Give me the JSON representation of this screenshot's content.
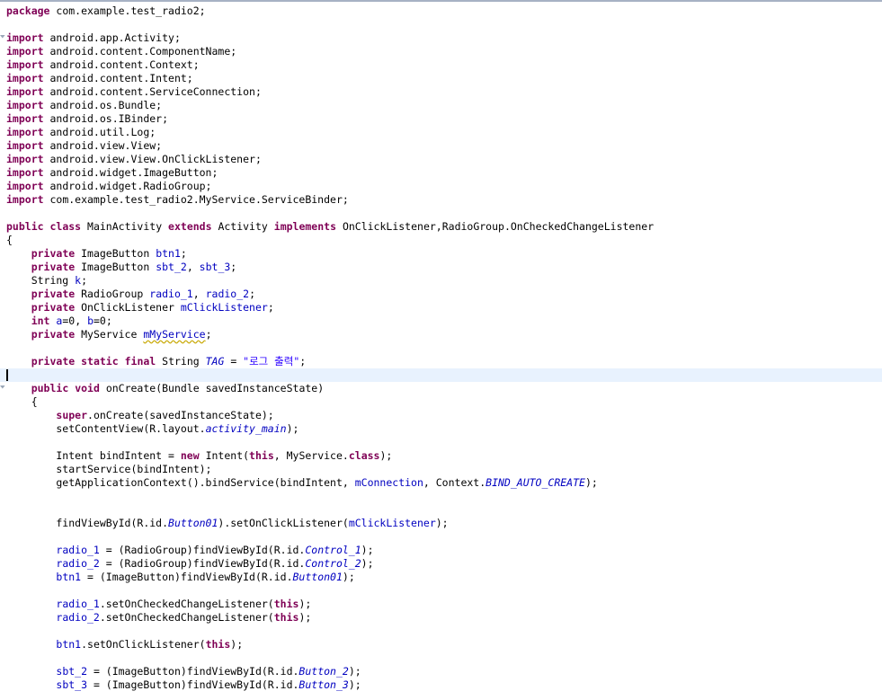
{
  "theme": {
    "keyword_color": "#7f0055",
    "field_color": "#0000c0",
    "string_color": "#2a00ff",
    "current_line_bg": "#e8f2fe"
  },
  "current_line_index": 27,
  "fold_markers": [
    2,
    28
  ],
  "code_lines": [
    [
      {
        "t": "package",
        "k": "kw"
      },
      {
        "t": " com.example.test_radio2;"
      }
    ],
    [],
    [
      {
        "t": "import",
        "k": "kw"
      },
      {
        "t": " android.app.Activity;"
      }
    ],
    [
      {
        "t": "import",
        "k": "kw"
      },
      {
        "t": " android.content.ComponentName;"
      }
    ],
    [
      {
        "t": "import",
        "k": "kw"
      },
      {
        "t": " android.content.Context;"
      }
    ],
    [
      {
        "t": "import",
        "k": "kw"
      },
      {
        "t": " android.content.Intent;"
      }
    ],
    [
      {
        "t": "import",
        "k": "kw"
      },
      {
        "t": " android.content.ServiceConnection;"
      }
    ],
    [
      {
        "t": "import",
        "k": "kw"
      },
      {
        "t": " android.os.Bundle;"
      }
    ],
    [
      {
        "t": "import",
        "k": "kw"
      },
      {
        "t": " android.os.IBinder;"
      }
    ],
    [
      {
        "t": "import",
        "k": "kw"
      },
      {
        "t": " android.util.Log;"
      }
    ],
    [
      {
        "t": "import",
        "k": "kw"
      },
      {
        "t": " android.view.View;"
      }
    ],
    [
      {
        "t": "import",
        "k": "kw"
      },
      {
        "t": " android.view.View.OnClickListener;"
      }
    ],
    [
      {
        "t": "import",
        "k": "kw"
      },
      {
        "t": " android.widget.ImageButton;"
      }
    ],
    [
      {
        "t": "import",
        "k": "kw"
      },
      {
        "t": " android.widget.RadioGroup;"
      }
    ],
    [
      {
        "t": "import",
        "k": "kw"
      },
      {
        "t": " com.example.test_radio2.MyService.ServiceBinder;"
      }
    ],
    [],
    [
      {
        "t": "public",
        "k": "kw"
      },
      {
        "t": " "
      },
      {
        "t": "class",
        "k": "kw"
      },
      {
        "t": " MainActivity "
      },
      {
        "t": "extends",
        "k": "kw"
      },
      {
        "t": " Activity "
      },
      {
        "t": "implements",
        "k": "kw"
      },
      {
        "t": " OnClickListener,RadioGroup.OnCheckedChangeListener"
      }
    ],
    [
      {
        "t": "{"
      }
    ],
    [
      {
        "t": "    "
      },
      {
        "t": "private",
        "k": "kw"
      },
      {
        "t": " ImageButton "
      },
      {
        "t": "btn1",
        "k": "field"
      },
      {
        "t": ";"
      }
    ],
    [
      {
        "t": "    "
      },
      {
        "t": "private",
        "k": "kw"
      },
      {
        "t": " ImageButton "
      },
      {
        "t": "sbt_2",
        "k": "field"
      },
      {
        "t": ", "
      },
      {
        "t": "sbt_3",
        "k": "field"
      },
      {
        "t": ";"
      }
    ],
    [
      {
        "t": "    String "
      },
      {
        "t": "k",
        "k": "field"
      },
      {
        "t": ";"
      }
    ],
    [
      {
        "t": "    "
      },
      {
        "t": "private",
        "k": "kw"
      },
      {
        "t": " RadioGroup "
      },
      {
        "t": "radio_1",
        "k": "field"
      },
      {
        "t": ", "
      },
      {
        "t": "radio_2",
        "k": "field"
      },
      {
        "t": ";"
      }
    ],
    [
      {
        "t": "    "
      },
      {
        "t": "private",
        "k": "kw"
      },
      {
        "t": " OnClickListener "
      },
      {
        "t": "mClickListener",
        "k": "field"
      },
      {
        "t": ";"
      }
    ],
    [
      {
        "t": "    "
      },
      {
        "t": "int",
        "k": "kw"
      },
      {
        "t": " "
      },
      {
        "t": "a",
        "k": "field"
      },
      {
        "t": "=0, "
      },
      {
        "t": "b",
        "k": "field"
      },
      {
        "t": "=0;"
      }
    ],
    [
      {
        "t": "    "
      },
      {
        "t": "private",
        "k": "kw"
      },
      {
        "t": " MyService "
      },
      {
        "t": "mMyService",
        "k": "field warn"
      },
      {
        "t": ";"
      }
    ],
    [],
    [
      {
        "t": "    "
      },
      {
        "t": "private",
        "k": "kw"
      },
      {
        "t": " "
      },
      {
        "t": "static",
        "k": "kw"
      },
      {
        "t": " "
      },
      {
        "t": "final",
        "k": "kw"
      },
      {
        "t": " String "
      },
      {
        "t": "TAG",
        "k": "static-field"
      },
      {
        "t": " = "
      },
      {
        "t": "\"로그 출력\"",
        "k": "str"
      },
      {
        "t": ";"
      }
    ],
    [],
    [
      {
        "t": "    "
      },
      {
        "t": "public",
        "k": "kw"
      },
      {
        "t": " "
      },
      {
        "t": "void",
        "k": "kw"
      },
      {
        "t": " onCreate(Bundle savedInstanceState)"
      }
    ],
    [
      {
        "t": "    {"
      }
    ],
    [
      {
        "t": "        "
      },
      {
        "t": "super",
        "k": "kw"
      },
      {
        "t": ".onCreate(savedInstanceState);"
      }
    ],
    [
      {
        "t": "        setContentView(R.layout."
      },
      {
        "t": "activity_main",
        "k": "static-field"
      },
      {
        "t": ");"
      }
    ],
    [],
    [
      {
        "t": "        Intent bindIntent = "
      },
      {
        "t": "new",
        "k": "kw"
      },
      {
        "t": " Intent("
      },
      {
        "t": "this",
        "k": "kw"
      },
      {
        "t": ", MyService."
      },
      {
        "t": "class",
        "k": "kw"
      },
      {
        "t": ");"
      }
    ],
    [
      {
        "t": "        startService(bindIntent);"
      }
    ],
    [
      {
        "t": "        getApplicationContext().bindService(bindIntent, "
      },
      {
        "t": "mConnection",
        "k": "field"
      },
      {
        "t": ", Context."
      },
      {
        "t": "BIND_AUTO_CREATE",
        "k": "static-field"
      },
      {
        "t": ");"
      }
    ],
    [],
    [],
    [
      {
        "t": "        findViewById(R.id."
      },
      {
        "t": "Button01",
        "k": "static-field"
      },
      {
        "t": ").setOnClickListener("
      },
      {
        "t": "mClickListener",
        "k": "field"
      },
      {
        "t": ");"
      }
    ],
    [],
    [
      {
        "t": "        "
      },
      {
        "t": "radio_1",
        "k": "field"
      },
      {
        "t": " = (RadioGroup)findViewById(R.id."
      },
      {
        "t": "Control_1",
        "k": "static-field"
      },
      {
        "t": ");"
      }
    ],
    [
      {
        "t": "        "
      },
      {
        "t": "radio_2",
        "k": "field"
      },
      {
        "t": " = (RadioGroup)findViewById(R.id."
      },
      {
        "t": "Control_2",
        "k": "static-field"
      },
      {
        "t": ");"
      }
    ],
    [
      {
        "t": "        "
      },
      {
        "t": "btn1",
        "k": "field"
      },
      {
        "t": " = (ImageButton)findViewById(R.id."
      },
      {
        "t": "Button01",
        "k": "static-field"
      },
      {
        "t": ");"
      }
    ],
    [],
    [
      {
        "t": "        "
      },
      {
        "t": "radio_1",
        "k": "field"
      },
      {
        "t": ".setOnCheckedChangeListener("
      },
      {
        "t": "this",
        "k": "kw"
      },
      {
        "t": ");"
      }
    ],
    [
      {
        "t": "        "
      },
      {
        "t": "radio_2",
        "k": "field"
      },
      {
        "t": ".setOnCheckedChangeListener("
      },
      {
        "t": "this",
        "k": "kw"
      },
      {
        "t": ");"
      }
    ],
    [],
    [
      {
        "t": "        "
      },
      {
        "t": "btn1",
        "k": "field"
      },
      {
        "t": ".setOnClickListener("
      },
      {
        "t": "this",
        "k": "kw"
      },
      {
        "t": ");"
      }
    ],
    [],
    [
      {
        "t": "        "
      },
      {
        "t": "sbt_2",
        "k": "field"
      },
      {
        "t": " = (ImageButton)findViewById(R.id."
      },
      {
        "t": "Button_2",
        "k": "static-field"
      },
      {
        "t": ");"
      }
    ],
    [
      {
        "t": "        "
      },
      {
        "t": "sbt_3",
        "k": "field"
      },
      {
        "t": " = (ImageButton)findViewById(R.id."
      },
      {
        "t": "Button_3",
        "k": "static-field"
      },
      {
        "t": ");"
      }
    ]
  ]
}
